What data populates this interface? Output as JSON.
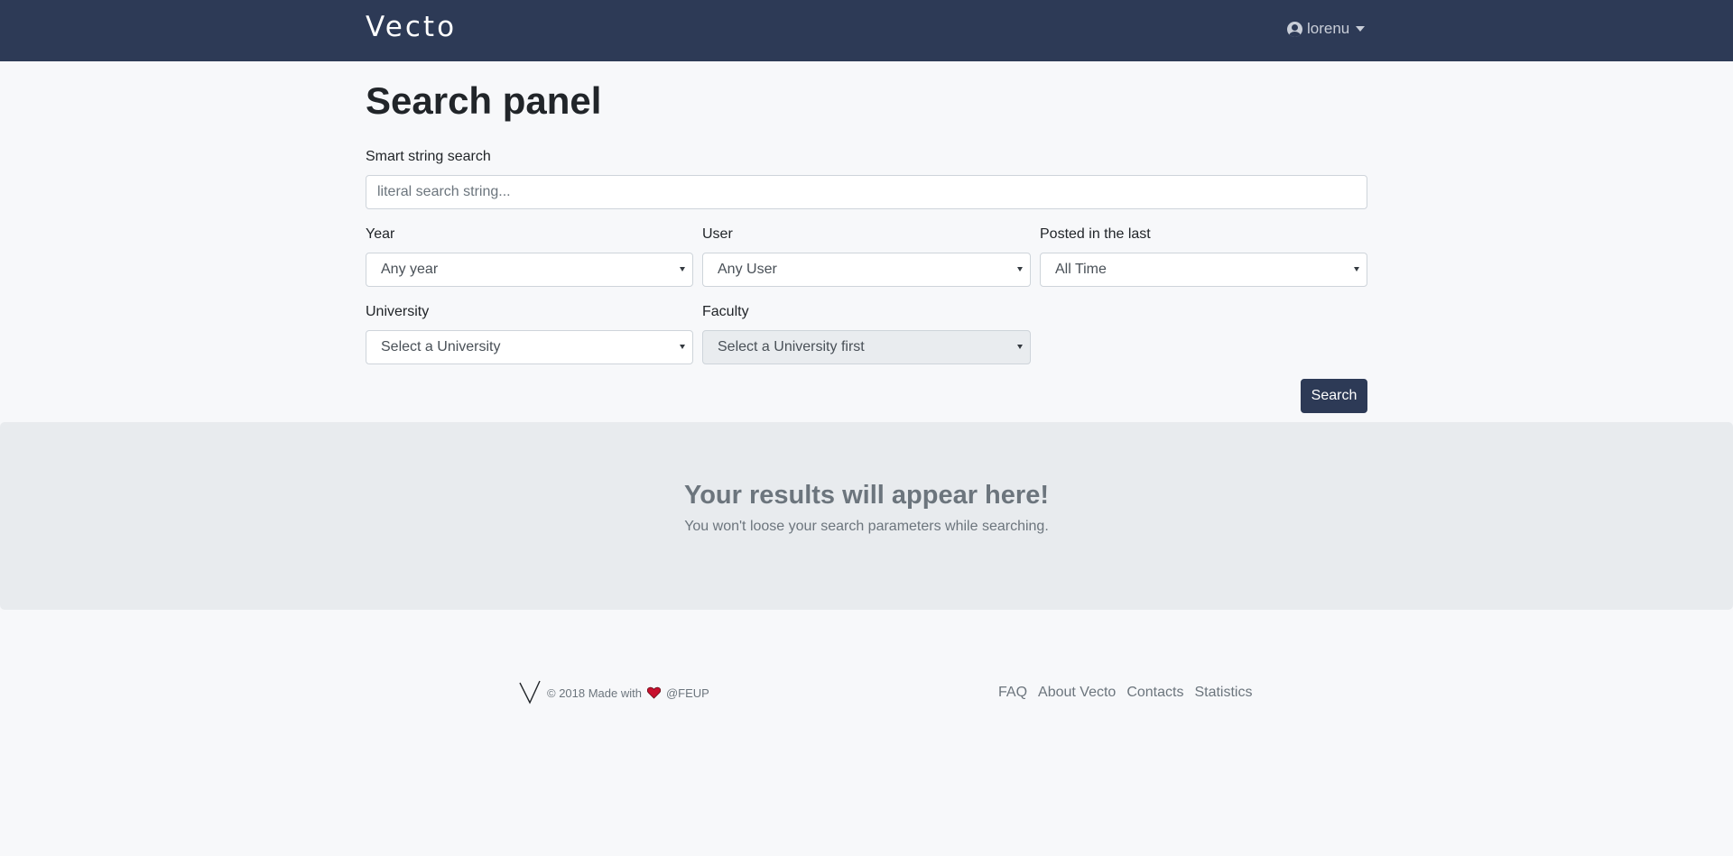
{
  "navbar": {
    "brand": "Vecto",
    "user": {
      "icon": "user-circle-icon",
      "name": "lorenu",
      "caret": "chevron-down-icon"
    }
  },
  "main": {
    "title": "Search panel",
    "smart_search": {
      "label": "Smart string search",
      "placeholder": "literal search string...",
      "value": ""
    },
    "filters": {
      "year": {
        "label": "Year",
        "selected": "Any year"
      },
      "user": {
        "label": "User",
        "selected": "Any User"
      },
      "posted": {
        "label": "Posted in the last",
        "selected": "All Time"
      },
      "university": {
        "label": "University",
        "selected": "Select a University"
      },
      "faculty": {
        "label": "Faculty",
        "selected": "Select a University first",
        "disabled": true
      }
    },
    "search_button": "Search"
  },
  "results": {
    "title": "Your results will appear here!",
    "subtitle": "You won't loose your search parameters while searching."
  },
  "footer": {
    "logo_icon": "v-logo-icon",
    "copyright_prefix": "© 2018 Made with",
    "heart_icon": "heart-icon",
    "copyright_suffix": "@FEUP",
    "links": [
      "FAQ",
      "About Vecto",
      "Contacts",
      "Statistics"
    ]
  },
  "colors": {
    "navbar_bg": "#2d3a56",
    "page_bg": "#f7f8fa",
    "results_bg": "#e8ebee",
    "heart": "#c8102e"
  }
}
